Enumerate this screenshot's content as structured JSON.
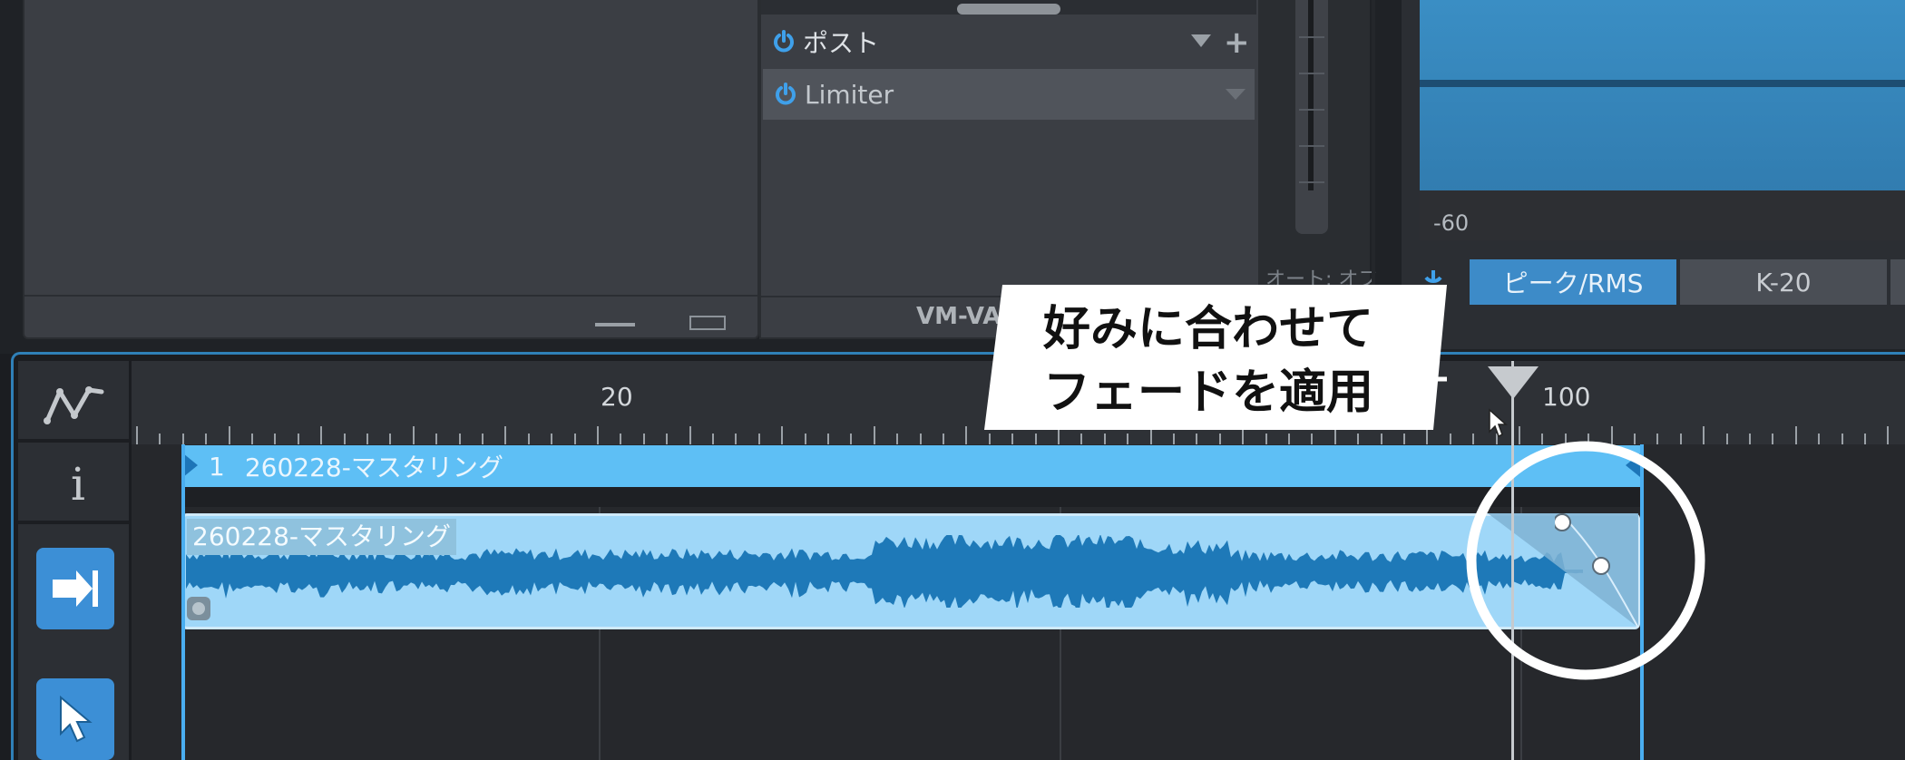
{
  "top_left_panel": {
    "minimize_icon": "minimize-icon",
    "restore_icon": "restore-icon"
  },
  "inserts": {
    "post": {
      "label": "ポスト",
      "icon": "power-icon"
    },
    "limiter": {
      "label": "Limiter",
      "icon": "power-icon"
    },
    "add_icon": "plus-icon",
    "dropdown_icon": "chevron-down-icon",
    "footer_label": "VM-VA"
  },
  "fader": {
    "automation_label": "オート: オフ"
  },
  "meter": {
    "scale_label": "-60",
    "tabs": [
      "ピーク/RMS",
      "K-20"
    ],
    "active_tab": "ピーク/RMS",
    "accent_color": "#3d8bc8"
  },
  "tools": {
    "automation_icon": "automation-icon",
    "info_icon": "info-icon",
    "snap_icon": "snap-arrow-icon",
    "pointer_icon": "arrow-cursor-icon",
    "accent_color": "#3c8fd6"
  },
  "ruler": {
    "marks": [
      "20",
      "100"
    ]
  },
  "track": {
    "number": "1",
    "name": "260228-マスタリング"
  },
  "clip": {
    "name": "260228-マスタリング"
  },
  "callout": {
    "line1": "好みに合わせて",
    "line2": "フェードを適用"
  }
}
